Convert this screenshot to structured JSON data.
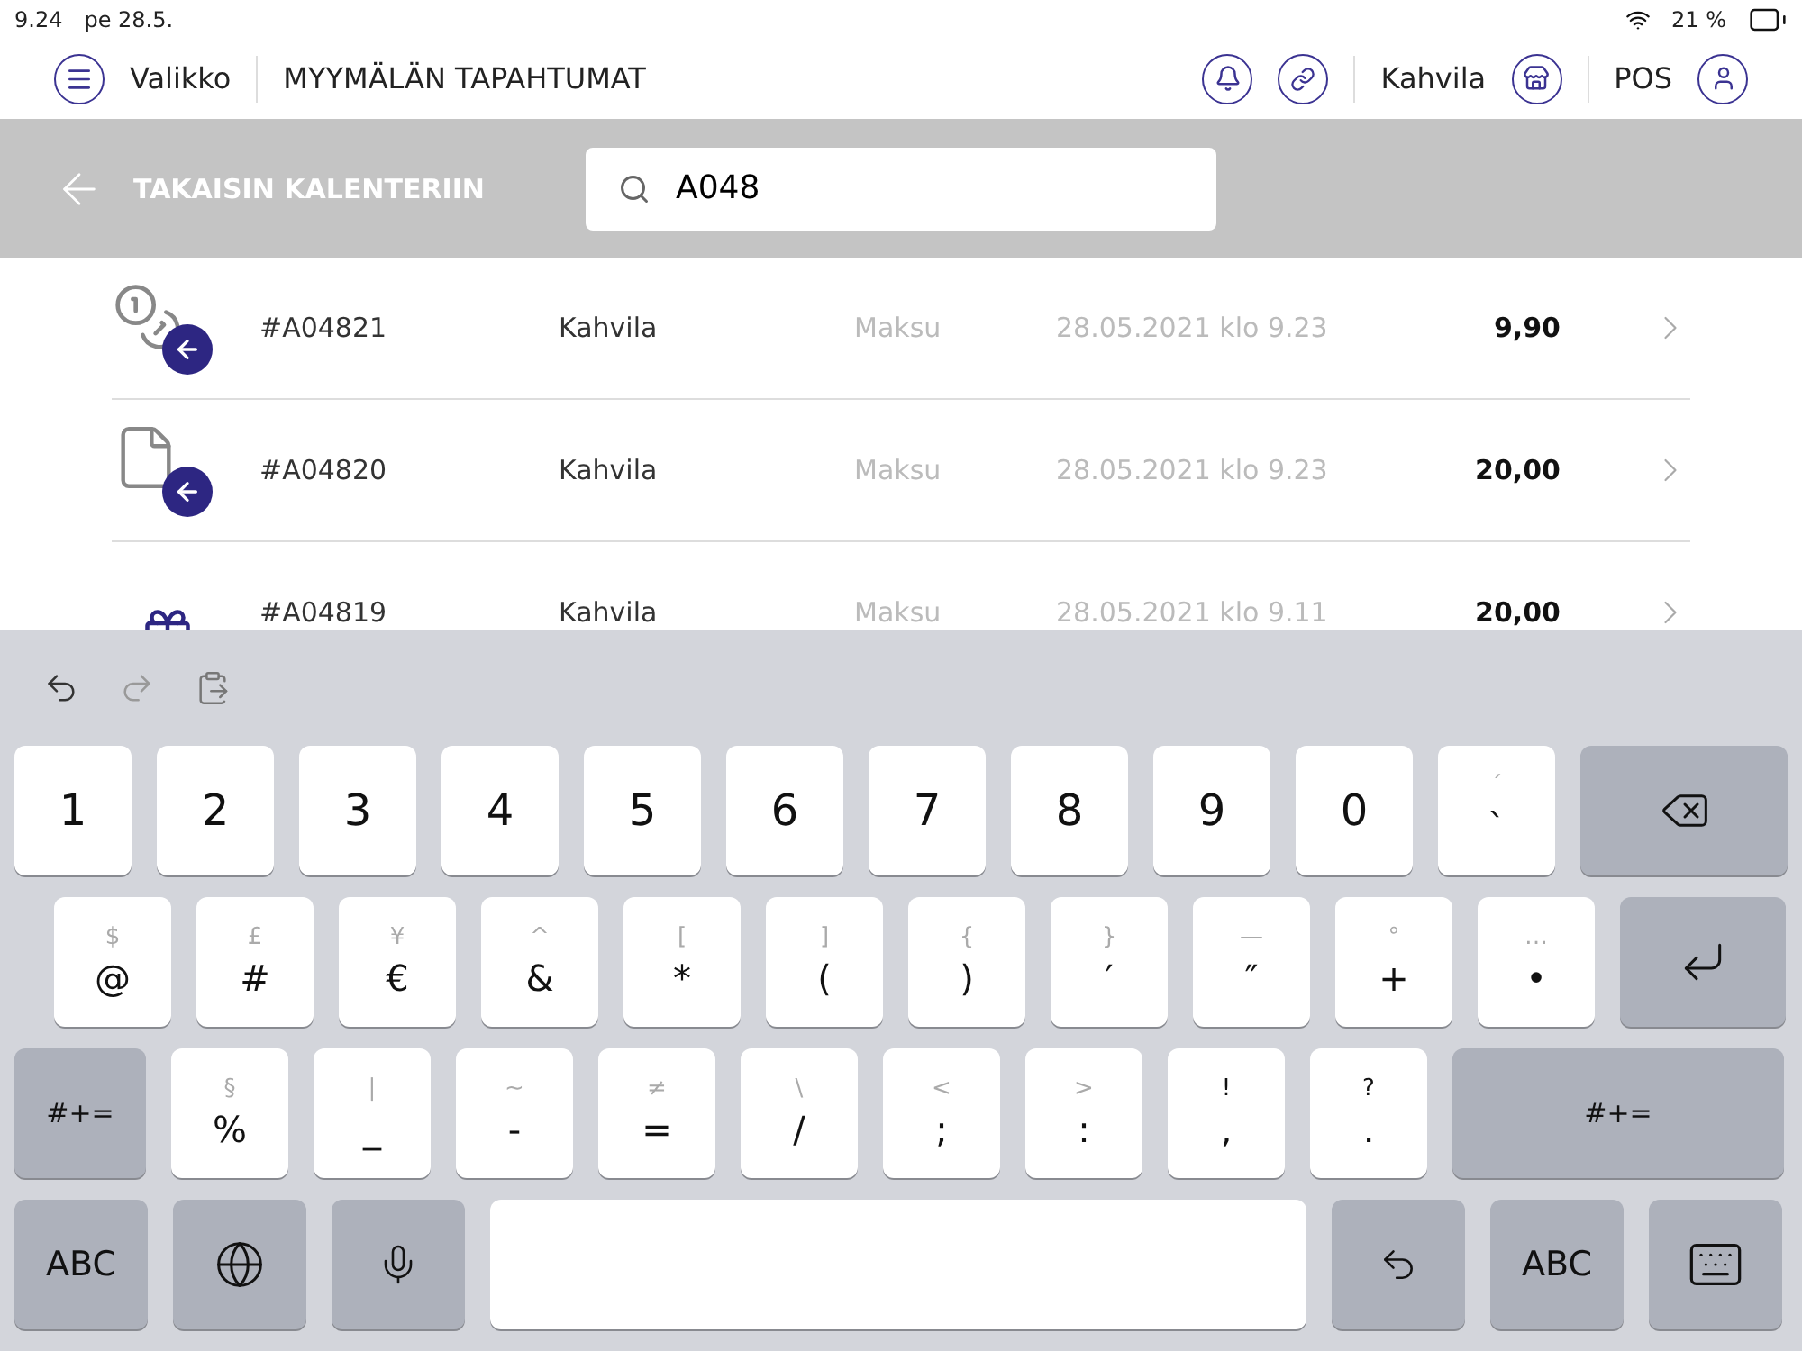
{
  "status_bar": {
    "time": "9.24",
    "date": "pe 28.5.",
    "battery": "21 %"
  },
  "header": {
    "menu_label": "Valikko",
    "title": "MYYMÄLÄN TAPAHTUMAT",
    "location": "Kahvila",
    "register": "POS"
  },
  "back_link": "TAKAISIN KALENTERIIN",
  "search": {
    "value": "A048"
  },
  "transactions": [
    {
      "kind": "coins",
      "id": "#A04821",
      "location": "Kahvila",
      "type": "Maksu",
      "datetime": "28.05.2021 klo 9.23",
      "amount": "9,90"
    },
    {
      "kind": "document",
      "id": "#A04820",
      "location": "Kahvila",
      "type": "Maksu",
      "datetime": "28.05.2021 klo 9.23",
      "amount": "20,00"
    },
    {
      "kind": "gift",
      "id": "#A04819",
      "location": "Kahvila",
      "type": "Maksu",
      "datetime": "28.05.2021 klo 9.11",
      "amount": "20,00"
    }
  ],
  "keyboard": {
    "rows": [
      [
        {
          "kind": "char",
          "label": "1"
        },
        {
          "kind": "char",
          "label": "2"
        },
        {
          "kind": "char",
          "label": "3"
        },
        {
          "kind": "char",
          "label": "4"
        },
        {
          "kind": "char",
          "label": "5"
        },
        {
          "kind": "char",
          "label": "6"
        },
        {
          "kind": "char",
          "label": "7"
        },
        {
          "kind": "char",
          "label": "8"
        },
        {
          "kind": "char",
          "label": "9"
        },
        {
          "kind": "char",
          "label": "0"
        },
        {
          "kind": "char",
          "hint": "´",
          "label": "`"
        },
        {
          "kind": "delete"
        }
      ],
      [
        {
          "kind": "char",
          "hint": "$",
          "label": "@"
        },
        {
          "kind": "char",
          "hint": "£",
          "label": "#"
        },
        {
          "kind": "char",
          "hint": "¥",
          "label": "€"
        },
        {
          "kind": "char",
          "hint": "^",
          "label": "&"
        },
        {
          "kind": "char",
          "hint": "[",
          "label": "*"
        },
        {
          "kind": "char",
          "hint": "]",
          "label": "("
        },
        {
          "kind": "char",
          "hint": "{",
          "label": ")"
        },
        {
          "kind": "char",
          "hint": "}",
          "label": "′"
        },
        {
          "kind": "char",
          "hint": "—",
          "label": "″"
        },
        {
          "kind": "char",
          "hint": "°",
          "label": "+"
        },
        {
          "kind": "char",
          "hint": "…",
          "label": "•"
        },
        {
          "kind": "return"
        }
      ],
      [
        {
          "kind": "function",
          "label": "#+="
        },
        {
          "kind": "char",
          "hint": "§",
          "label": "%"
        },
        {
          "kind": "char",
          "hint": "|",
          "label": "_"
        },
        {
          "kind": "char",
          "hint": "~",
          "label": "-"
        },
        {
          "kind": "char",
          "hint": "≠",
          "label": "="
        },
        {
          "kind": "char",
          "hint": "\\",
          "label": "/"
        },
        {
          "kind": "char",
          "hint": "<",
          "label": ";"
        },
        {
          "kind": "char",
          "hint": ">",
          "label": ":"
        },
        {
          "kind": "dual",
          "hint": "!",
          "label": ","
        },
        {
          "kind": "dual",
          "hint": "?",
          "label": "."
        },
        {
          "kind": "wide",
          "label": "#+="
        }
      ],
      [
        {
          "kind": "function",
          "label": "ABC"
        },
        {
          "kind": "globe"
        },
        {
          "kind": "mic"
        },
        {
          "kind": "space"
        },
        {
          "kind": "undo"
        },
        {
          "kind": "function",
          "label": "ABC"
        },
        {
          "kind": "hide"
        }
      ]
    ]
  }
}
